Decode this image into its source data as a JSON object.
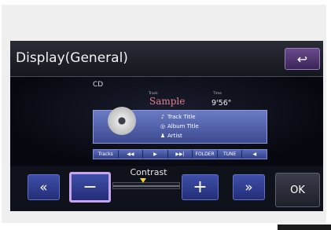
{
  "header": {
    "title": "Display(General)",
    "back_icon": "↩"
  },
  "preview": {
    "source": "CD",
    "track_label": "Track",
    "time_label": "Time",
    "song": "Sample",
    "time": "9'56\"",
    "lines": [
      {
        "icon": "♪",
        "text": "Track Title"
      },
      {
        "icon": "◎",
        "text": "Album Title"
      },
      {
        "icon": "♟",
        "text": "Artist"
      }
    ],
    "controls": [
      "Tracks",
      "◀◀",
      "▶",
      "▶▶|",
      "FOLDER",
      "TUNE",
      "◀"
    ]
  },
  "contrast": {
    "label": "Contrast",
    "level": 0.45,
    "prev_label": "«",
    "minus_label": "−",
    "plus_label": "+",
    "next_label": "»",
    "ok_label": "OK"
  }
}
